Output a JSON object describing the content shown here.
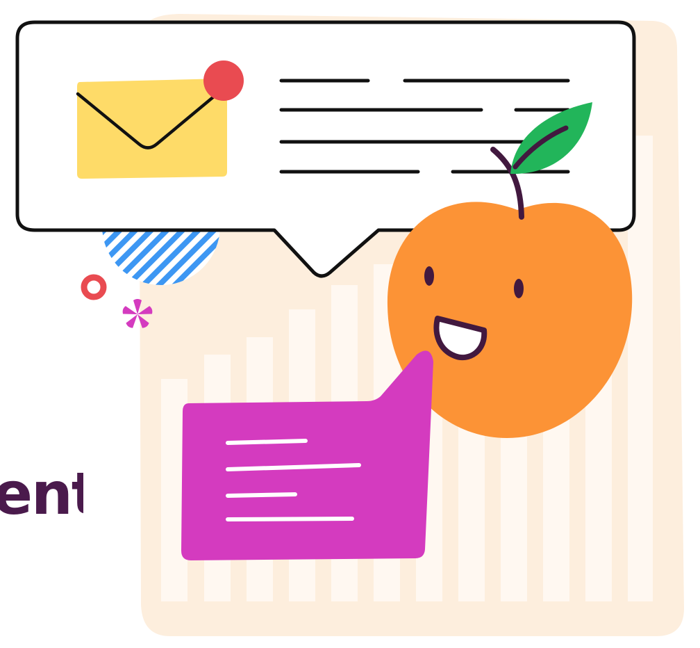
{
  "headline": {
    "text": "ent"
  },
  "colors": {
    "background_panel": "#fdeedd",
    "bar_fill": "#fff8f1",
    "email_bubble_fill": "#ffffff",
    "outline": "#111111",
    "envelope": "#fedb68",
    "notification_dot": "#e94b51",
    "stripe_circle": "#3d97f3",
    "ring": "#e94b51",
    "sparkle": "#d43bbf",
    "peach_body": "#fc9336",
    "peach_face": "#42193f",
    "leaf": "#22b55a",
    "chat_bubble": "#d43bbf",
    "chat_lines": "#ffffff",
    "headline_text": "#4a1a4c"
  },
  "icons": {
    "envelope": "envelope-icon",
    "notification": "notification-dot-icon",
    "peach": "peach-mascot-icon",
    "leaf": "leaf-icon",
    "sparkle": "sparkle-icon",
    "ring": "ring-icon"
  }
}
